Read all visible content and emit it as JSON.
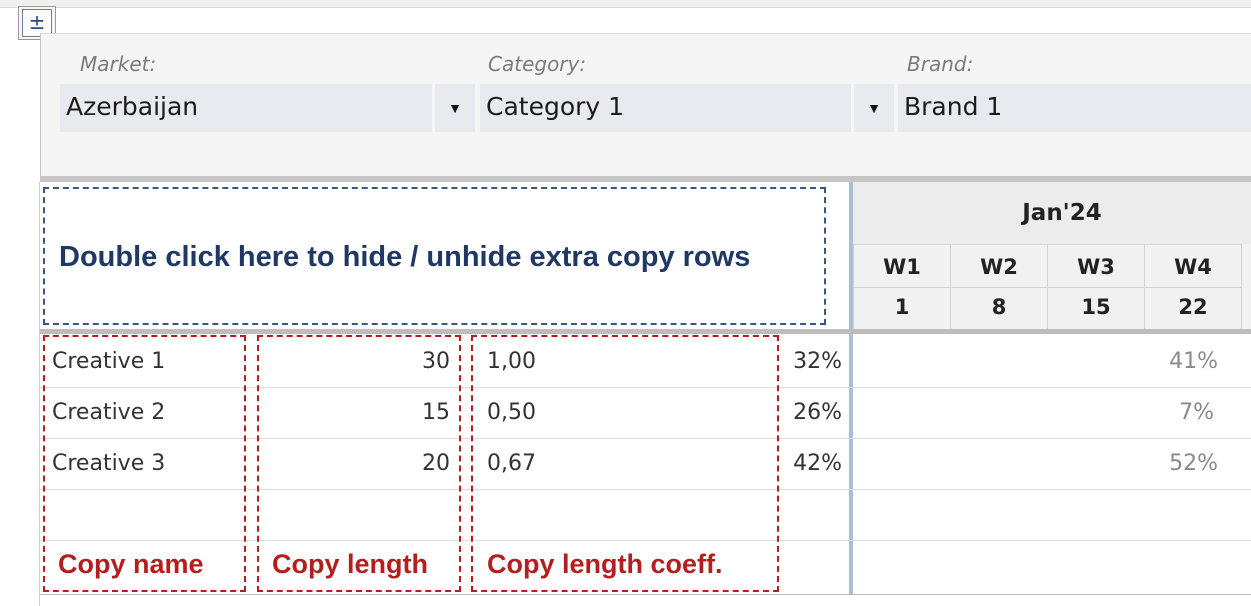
{
  "toolbar": {
    "toggle_symbol": "±"
  },
  "filters": {
    "market": {
      "label": "Market:",
      "value": "Azerbaijan"
    },
    "category": {
      "label": "Category:",
      "value": "Category 1"
    },
    "brand": {
      "label": "Brand:",
      "value": "Brand 1"
    },
    "dropdown_glyph": "▼"
  },
  "hint": "Double click here to hide / unhide extra copy rows",
  "calendar": {
    "month": "Jan'24",
    "weeks": [
      {
        "label": "W1",
        "day": "1"
      },
      {
        "label": "W2",
        "day": "8"
      },
      {
        "label": "W3",
        "day": "15"
      },
      {
        "label": "W4",
        "day": "22"
      }
    ]
  },
  "rows": [
    {
      "name": "Creative 1",
      "length": "30",
      "coeff": "1,00",
      "share": "32%",
      "w4_share": "41%"
    },
    {
      "name": "Creative 2",
      "length": "15",
      "coeff": "0,50",
      "share": "26%",
      "w4_share": "7%"
    },
    {
      "name": "Creative 3",
      "length": "20",
      "coeff": "0,67",
      "share": "42%",
      "w4_share": "52%"
    }
  ],
  "annotations": {
    "copy_name": "Copy name",
    "copy_length": "Copy length",
    "copy_length_coeff": "Copy length coeff."
  },
  "colors": {
    "accent_red": "#b31f1f",
    "hint_blue": "#1f3864",
    "divider": "#a9bfd8"
  }
}
